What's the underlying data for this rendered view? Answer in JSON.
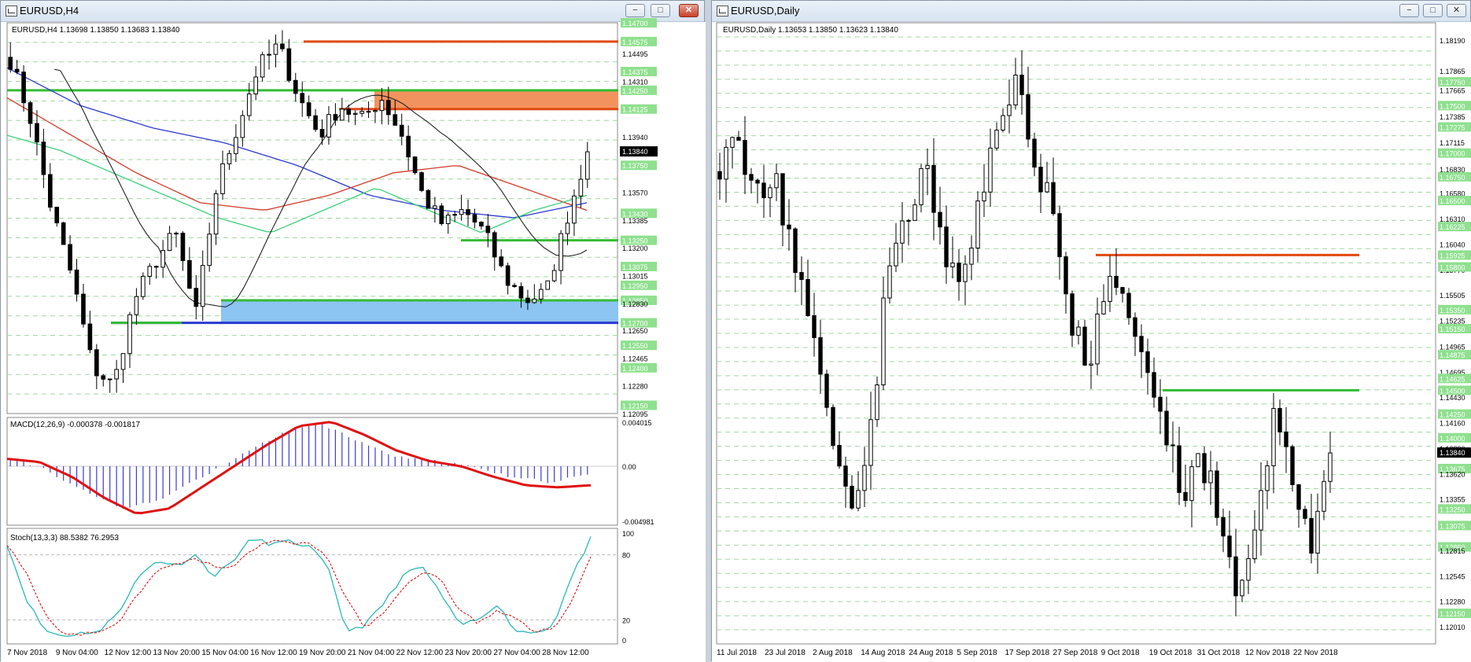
{
  "left": {
    "window_title": "EURUSD,H4",
    "chart_header": "EURUSD,H4  1.13698 1.13850 1.13683 1.13840",
    "current_price": "1.13840",
    "right_axis_labels": [
      "1.14700",
      "1.14575",
      "1.14495",
      "1.14375",
      "1.14310",
      "1.14250",
      "1.14125",
      "1.13940",
      "1.13750",
      "1.13570",
      "1.13430",
      "1.13385",
      "1.13250",
      "1.13200",
      "1.13075",
      "1.13015",
      "1.12950",
      "1.12850",
      "1.12830",
      "1.12700",
      "1.12650",
      "1.12550",
      "1.12465",
      "1.12400",
      "1.12280",
      "1.12150",
      "1.12095"
    ],
    "time_labels": [
      "7 Nov 2018",
      "9 Nov 04:00",
      "12 Nov 12:00",
      "13 Nov 20:00",
      "15 Nov 04:00",
      "16 Nov 12:00",
      "19 Nov 20:00",
      "21 Nov 04:00",
      "22 Nov 12:00",
      "23 Nov 20:00",
      "27 Nov 04:00",
      "28 Nov 12:00"
    ],
    "macd_label": "MACD(12,26,9) -0.000378 -0.001817",
    "macd_axis": [
      "0.004015",
      "0.00",
      "-0.004981"
    ],
    "stoch_label": "Stoch(13,3,3) 88.5382 76.2953",
    "stoch_axis": [
      "100",
      "80",
      "20",
      "0"
    ],
    "colors": {
      "support": "#33bb33",
      "resistance": "#e04a10",
      "zone_supply": "#f2935f",
      "zone_demand": "#8cc4f2",
      "ma_blue": "#2a3ad0",
      "ma_red": "#d23a2a",
      "ma_green": "#3ad07a",
      "ma_black": "#222222",
      "macd_hist": "#3a3ad8",
      "macd_signal": "#e01010",
      "stoch_main": "#2ab8b8",
      "stoch_signal": "#e01010"
    }
  },
  "right": {
    "window_title": "EURUSD,Daily",
    "chart_header": "EURUSD,Daily  1.13653 1.13850 1.13623 1.13840",
    "current_price": "1.13840",
    "right_axis_labels": [
      "1.18190",
      "1.17865",
      "1.17750",
      "1.17665",
      "1.17500",
      "1.17385",
      "1.17275",
      "1.17115",
      "1.17000",
      "1.16830",
      "1.16750",
      "1.16580",
      "1.16500",
      "1.16310",
      "1.16225",
      "1.16040",
      "1.15925",
      "1.15770",
      "1.15800",
      "1.15505",
      "1.15350",
      "1.15235",
      "1.15150",
      "1.14965",
      "1.14875",
      "1.14695",
      "1.14625",
      "1.14500",
      "1.14430",
      "1.14250",
      "1.14160",
      "1.14000",
      "1.13890",
      "1.13840",
      "1.13675",
      "1.13620",
      "1.13355",
      "1.13250",
      "1.13085",
      "1.13075",
      "1.12850",
      "1.12815",
      "1.12545",
      "1.12280",
      "1.12150",
      "1.12010"
    ],
    "time_labels": [
      "11 Jul 2018",
      "23 Jul 2018",
      "2 Aug 2018",
      "14 Aug 2018",
      "24 Aug 2018",
      "5 Sep 2018",
      "17 Sep 2018",
      "27 Sep 2018",
      "9 Oct 2018",
      "19 Oct 2018",
      "31 Oct 2018",
      "12 Nov 2018",
      "22 Nov 2018"
    ]
  },
  "controls": {
    "minimize": "−",
    "maximize": "□",
    "close": "✕"
  }
}
